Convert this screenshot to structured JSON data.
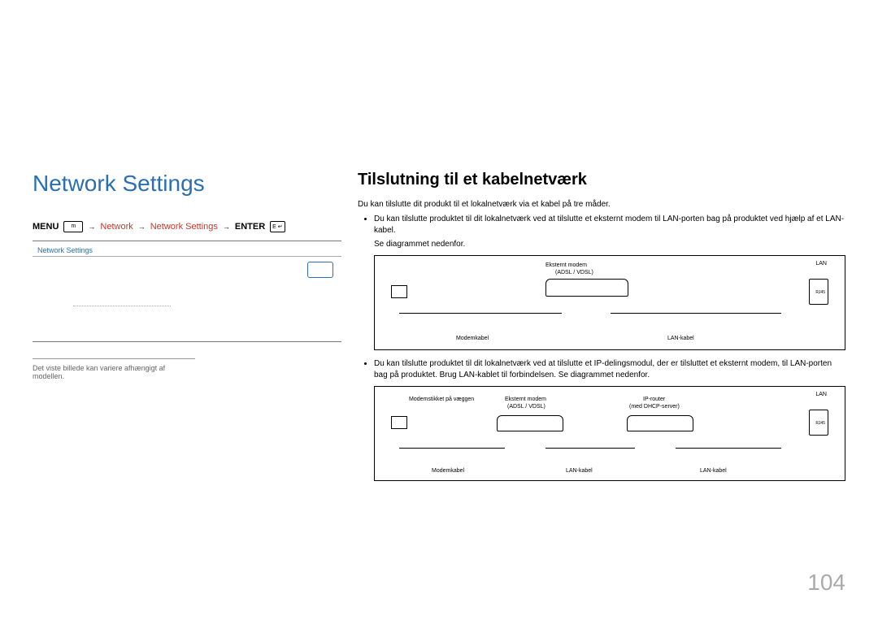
{
  "left": {
    "title": "Network Settings",
    "menu_label": "MENU",
    "path1": "Network",
    "path2": "Network Settings",
    "enter_label": "ENTER",
    "window_header": "Network Settings",
    "note": "Det viste billede kan variere afhængigt af modellen."
  },
  "right": {
    "section_title": "Tilslutning til et kabelnetværk",
    "intro": "Du kan tilslutte dit produkt til et lokalnetværk via et kabel på tre måder.",
    "bullet1": "Du kan tilslutte produktet til dit lokalnetværk ved at tilslutte et eksternt modem til LAN-porten bag på produktet ved hjælp af et LAN-kabel.",
    "bullet1_sub": "Se diagrammet nedenfor.",
    "diagram1": {
      "modem_label_top": "Eksternt modem",
      "modem_label_sub": "(ADSL / VDSL)",
      "lan_label": "LAN",
      "rj_label": "RJ45",
      "cable_left": "Modemkabel",
      "cable_right": "LAN-kabel"
    },
    "bullet2": "Du kan tilslutte produktet til dit lokalnetværk ved at tilslutte et IP-delingsmodul, der er tilsluttet et eksternt modem, til LAN-porten bag på produktet. Brug LAN-kablet til forbindelsen. Se diagrammet nedenfor.",
    "diagram2": {
      "wall_label": "Modemstikket på væggen",
      "modem_label_top": "Eksternt modem",
      "modem_label_sub": "(ADSL / VDSL)",
      "router_top": "IP-router",
      "router_sub": "(med DHCP-server)",
      "lan_label": "LAN",
      "rj_label": "RJ45",
      "cable_a": "Modemkabel",
      "cable_b": "LAN-kabel",
      "cable_c": "LAN-kabel"
    }
  },
  "page_number": "104"
}
